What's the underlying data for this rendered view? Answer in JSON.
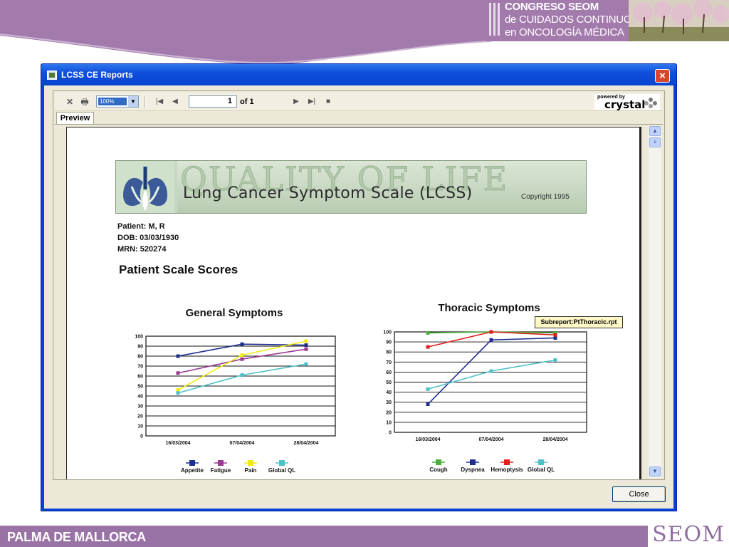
{
  "slide": {
    "conference_lines": [
      "CONGRESO SEOM",
      "de CUIDADOS CONTINUOS",
      "en ONCOLOGÍA MÉDICA"
    ],
    "footer_city": "PALMA DE MALLORCA",
    "footer_logo": "SEOM",
    "accent_color": "#9a73a6"
  },
  "window": {
    "title": "LCSS CE Reports",
    "close_icon": "×",
    "close_button": "Close"
  },
  "toolbar": {
    "zoom": "100%",
    "page_current": "1",
    "page_total_label": "of 1",
    "powered_by": "powered by",
    "brand": "crystal",
    "tab_preview": "Preview"
  },
  "report": {
    "banner_watermark": "QUALITY OF LIFE",
    "banner_title": "Lung Cancer Symptom Scale (LCSS)",
    "banner_copyright": "Copyright 1995",
    "patient_label": "Patient:",
    "patient_value": "M, R",
    "dob_label": "DOB:",
    "dob_value": "03/03/1930",
    "mrn_label": "MRN:",
    "mrn_value": "520274",
    "heading": "Patient Scale Scores",
    "subreport_tag": "Subreport:PtThoracic.rpt"
  },
  "chart_data": [
    {
      "type": "line",
      "title": "General Symptoms",
      "categories": [
        "16/03/2004",
        "07/04/2004",
        "28/04/2004"
      ],
      "ylim": [
        0,
        100
      ],
      "yticks": [
        0,
        10,
        20,
        30,
        40,
        50,
        60,
        70,
        80,
        90,
        100
      ],
      "grid": true,
      "legend": "bottom",
      "series": [
        {
          "name": "Appetite",
          "color": "#1f2f8f",
          "values": [
            80,
            92,
            91
          ]
        },
        {
          "name": "Fatigue",
          "color": "#9b3a93",
          "values": [
            63,
            77,
            87
          ]
        },
        {
          "name": "Pain",
          "color": "#f2ea14",
          "values": [
            46,
            81,
            95
          ]
        },
        {
          "name": "Global QL",
          "color": "#4ec1c8",
          "values": [
            43,
            61,
            72
          ]
        }
      ]
    },
    {
      "type": "line",
      "title": "Thoracic Symptoms",
      "categories": [
        "16/03/2004",
        "07/04/2004",
        "28/04/2004"
      ],
      "ylim": [
        0,
        100
      ],
      "yticks": [
        0,
        10,
        20,
        30,
        40,
        50,
        60,
        70,
        80,
        90,
        100
      ],
      "grid": true,
      "legend": "bottom",
      "series": [
        {
          "name": "Cough",
          "color": "#4caf3a",
          "values": [
            99,
            100,
            99
          ]
        },
        {
          "name": "Dyspnea",
          "color": "#1f2f8f",
          "values": [
            28,
            92,
            94
          ]
        },
        {
          "name": "Hemoptysis",
          "color": "#e0201b",
          "values": [
            85,
            100,
            97
          ]
        },
        {
          "name": "Global QL",
          "color": "#4ec1c8",
          "values": [
            43,
            61,
            72
          ]
        }
      ]
    }
  ]
}
